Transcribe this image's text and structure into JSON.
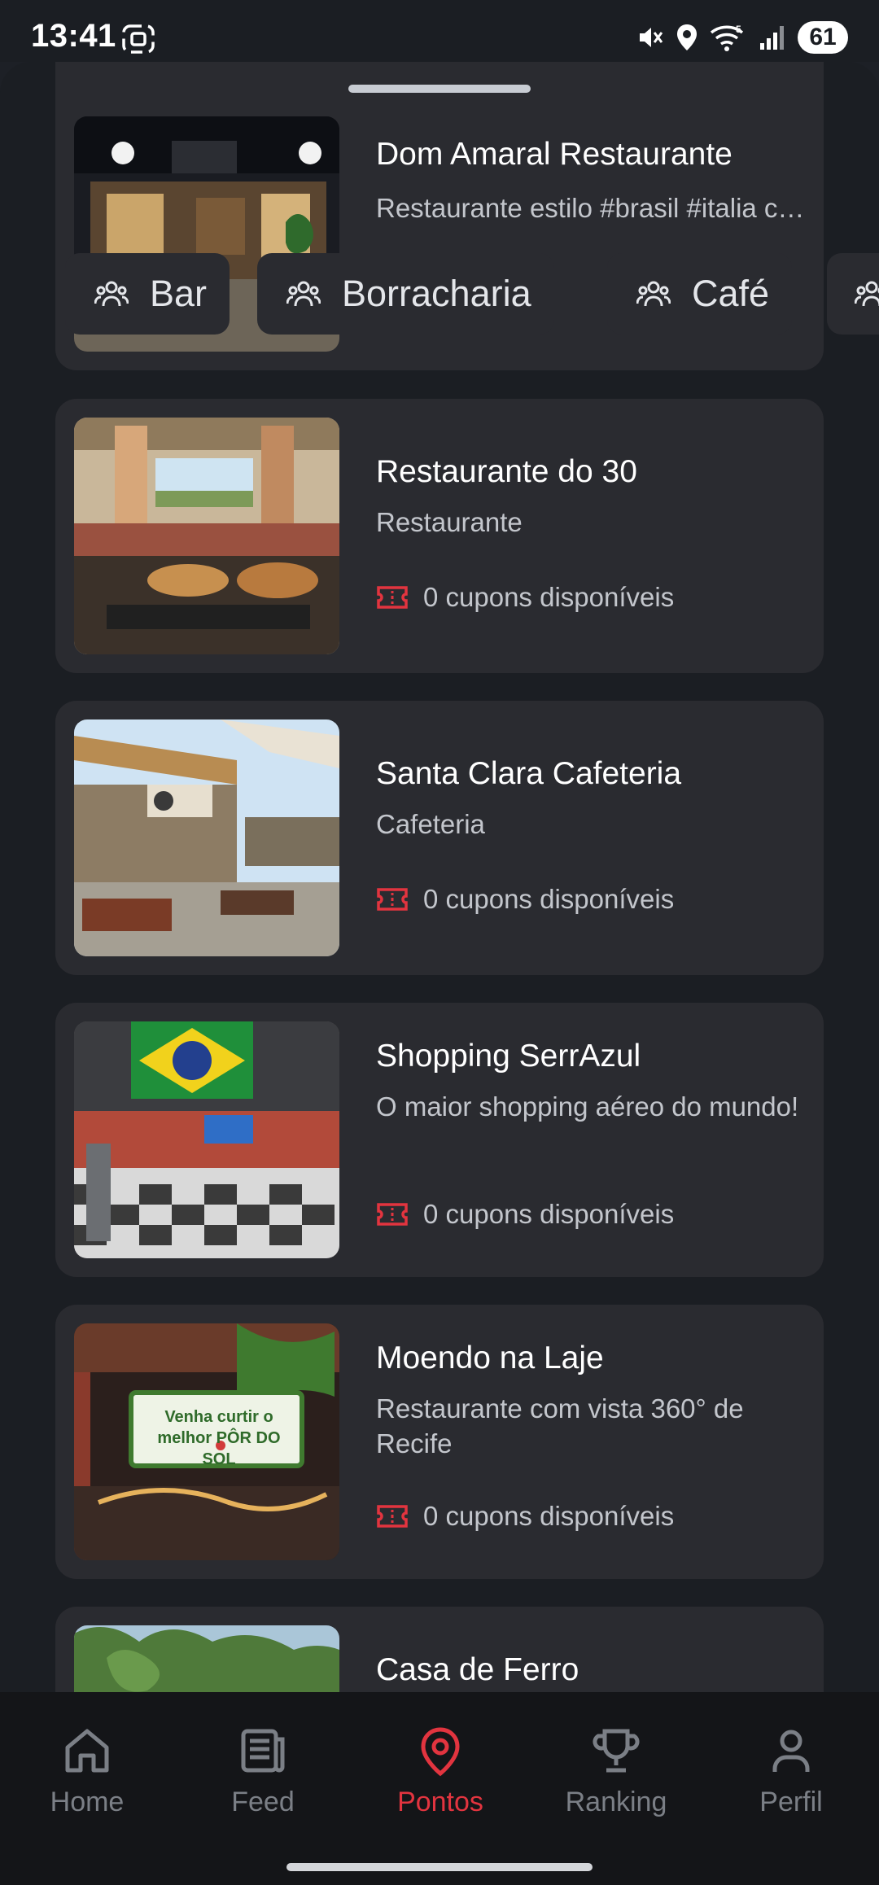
{
  "status_bar": {
    "time": "13:41",
    "battery": "61",
    "icons": [
      "screenshot-icon",
      "mute-icon",
      "location-icon",
      "wifi-icon",
      "signal-icon"
    ]
  },
  "categories": [
    {
      "label": "Bar",
      "icon": "people-icon"
    },
    {
      "label": "Borracharia",
      "icon": "people-icon"
    },
    {
      "label": "Café",
      "icon": "people-icon"
    }
  ],
  "places": [
    {
      "title": "Dom Amaral Restaurante",
      "description": "Restaurante estilo #brasil #italia com deliciosas opções...",
      "coupons": ""
    },
    {
      "title": "Restaurante do 30",
      "description": "Restaurante",
      "coupons": "0 cupons disponíveis"
    },
    {
      "title": "Santa Clara Cafeteria",
      "description": "Cafeteria",
      "coupons": "0 cupons disponíveis"
    },
    {
      "title": "Shopping SerrAzul",
      "description": "O maior shopping aéreo do mundo!",
      "coupons": "0 cupons disponíveis"
    },
    {
      "title": "Moendo na Laje",
      "description": "Restaurante com vista 360° de Recife",
      "coupons": "0 cupons disponíveis"
    },
    {
      "title": "Casa de Ferro",
      "description": "",
      "coupons": ""
    }
  ],
  "nav": {
    "items": [
      {
        "label": "Home",
        "icon": "home-icon"
      },
      {
        "label": "Feed",
        "icon": "feed-icon"
      },
      {
        "label": "Pontos",
        "icon": "location-pin-icon",
        "active": true
      },
      {
        "label": "Ranking",
        "icon": "trophy-icon"
      },
      {
        "label": "Perfil",
        "icon": "person-icon"
      }
    ]
  },
  "colors": {
    "background": "#1b1e23",
    "card": "#2a2b30",
    "accent": "#e2343f",
    "muted_text": "#c3c6cc",
    "nav_inactive": "#7b7f86"
  }
}
